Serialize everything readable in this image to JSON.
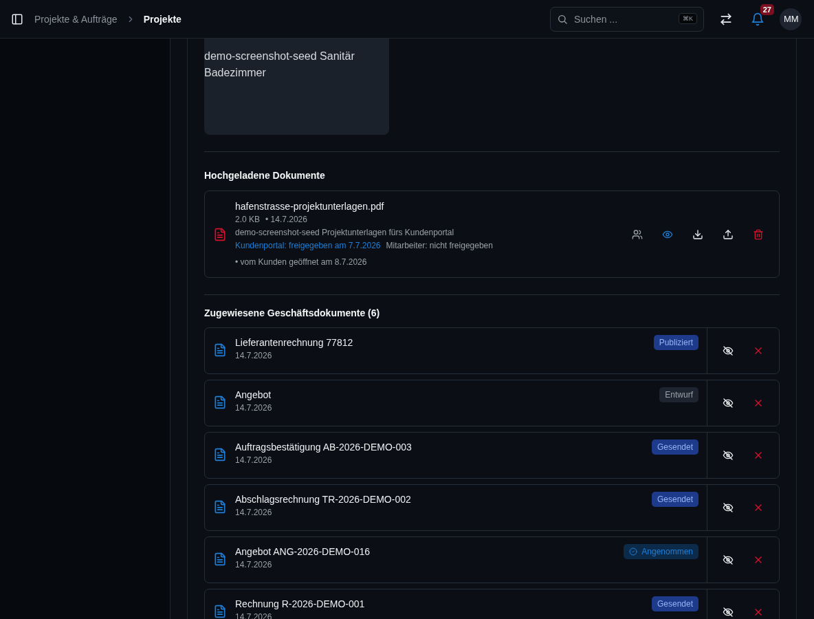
{
  "header": {
    "breadcrumb": [
      {
        "label": "Projekte & Aufträge",
        "current": false
      },
      {
        "label": "Projekte",
        "current": true
      }
    ],
    "search": {
      "placeholder": "Suchen ...",
      "shortcut": "⌘K"
    },
    "notifications": {
      "count": "27"
    },
    "avatar": "MM"
  },
  "image": {
    "alt": "demo-screenshot-seed Sanitär Badezimmer"
  },
  "uploaded": {
    "title": "Hochgeladene Dokumente",
    "documents": [
      {
        "name": "hafenstrasse-projektunterlagen.pdf",
        "size": "2.0 KB",
        "date": "• 14.7.2026",
        "description": "demo-screenshot-seed Projektunterlagen fürs Kundenportal",
        "portal": "Kundenportal: freigegeben am 7.7.2026",
        "staff": "Mitarbeiter: nicht freigegeben",
        "opened": "• vom Kunden geöffnet am 8.7.2026",
        "visible": true
      }
    ]
  },
  "assigned": {
    "title": "Zugewiesene Geschäftsdokumente (6)",
    "rows": [
      {
        "name": "Lieferantenrechnung 77812",
        "date": "14.7.2026",
        "status": "Publiziert",
        "kind": "published"
      },
      {
        "name": "Angebot",
        "date": "14.7.2026",
        "status": "Entwurf",
        "kind": "draft"
      },
      {
        "name": "Auftragsbestätigung AB-2026-DEMO-003",
        "date": "14.7.2026",
        "status": "Gesendet",
        "kind": "sent"
      },
      {
        "name": "Abschlagsrechnung TR-2026-DEMO-002",
        "date": "14.7.2026",
        "status": "Gesendet",
        "kind": "sent"
      },
      {
        "name": "Angebot ANG-2026-DEMO-016",
        "date": "14.7.2026",
        "status": "Angenommen",
        "kind": "accepted"
      },
      {
        "name": "Rechnung R-2026-DEMO-001",
        "date": "14.7.2026",
        "status": "Gesendet",
        "kind": "sent"
      }
    ]
  }
}
